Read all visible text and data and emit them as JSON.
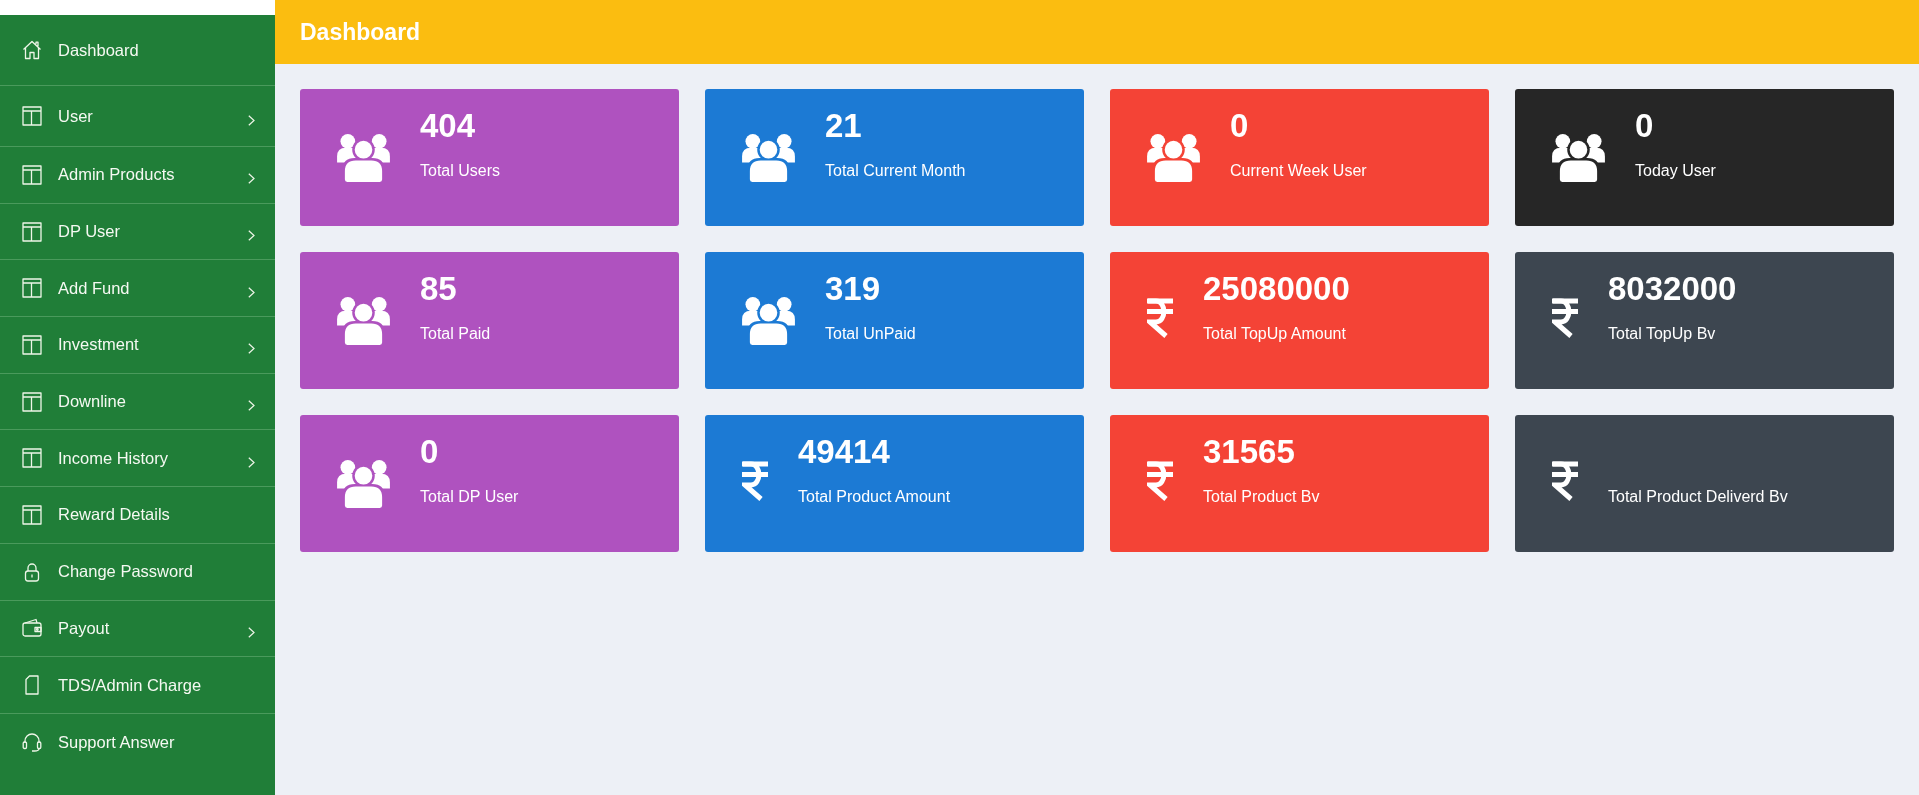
{
  "header": {
    "title": "Dashboard"
  },
  "sidebar": {
    "items": [
      {
        "label": "Dashboard",
        "kind": "home",
        "submenu": false
      },
      {
        "label": "User",
        "kind": "module",
        "submenu": true
      },
      {
        "label": "Admin Products",
        "kind": "module",
        "submenu": true
      },
      {
        "label": "DP User",
        "kind": "module",
        "submenu": true
      },
      {
        "label": "Add Fund",
        "kind": "module",
        "submenu": true
      },
      {
        "label": "Investment",
        "kind": "module",
        "submenu": true
      },
      {
        "label": "Downline",
        "kind": "module",
        "submenu": true
      },
      {
        "label": "Income History",
        "kind": "module",
        "submenu": true
      },
      {
        "label": "Reward Details",
        "kind": "module",
        "submenu": false
      },
      {
        "label": "Change Password",
        "kind": "security",
        "submenu": false
      },
      {
        "label": "Payout",
        "kind": "payout",
        "submenu": true
      },
      {
        "label": "TDS/Admin Charge",
        "kind": "report",
        "submenu": false
      },
      {
        "label": "Support Answer",
        "kind": "support",
        "submenu": false
      }
    ]
  },
  "cards": [
    {
      "value": "404",
      "label": "Total Users",
      "kind": "users",
      "color": "#af52bf"
    },
    {
      "value": "21",
      "label": "Total Current Month",
      "kind": "users",
      "color": "#1c7ad4"
    },
    {
      "value": "0",
      "label": "Current Week User",
      "kind": "users",
      "color": "#f44336"
    },
    {
      "value": "0",
      "label": "Today User",
      "kind": "users",
      "color": "#262626"
    },
    {
      "value": "85",
      "label": "Total Paid",
      "kind": "users",
      "color": "#af52bf"
    },
    {
      "value": "319",
      "label": "Total UnPaid",
      "kind": "users",
      "color": "#1c7ad4"
    },
    {
      "value": "25080000",
      "label": "Total TopUp Amount",
      "kind": "amount",
      "color": "#f44336"
    },
    {
      "value": "8032000",
      "label": "Total TopUp Bv",
      "kind": "amount",
      "color": "#3d4650"
    },
    {
      "value": "0",
      "label": "Total DP User",
      "kind": "users",
      "color": "#af52bf"
    },
    {
      "value": "49414",
      "label": "Total Product Amount",
      "kind": "amount",
      "color": "#1c7ad4"
    },
    {
      "value": "31565",
      "label": "Total Product Bv",
      "kind": "amount",
      "color": "#f44336"
    },
    {
      "label": "Total Product Deliverd Bv",
      "kind": "amount",
      "color": "#3d4650"
    }
  ]
}
